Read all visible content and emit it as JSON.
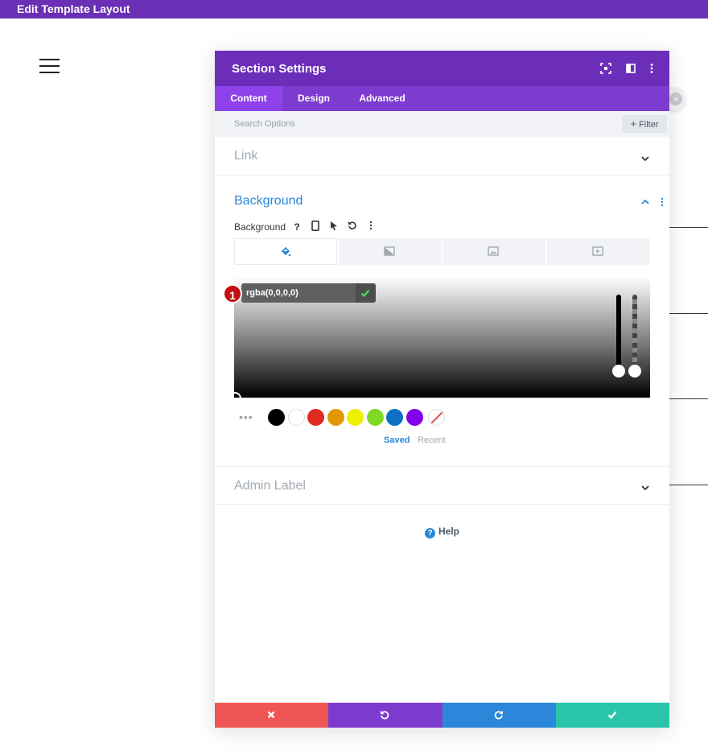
{
  "topbar": {
    "title": "Edit Template Layout"
  },
  "modal": {
    "title": "Section Settings",
    "tabs": [
      {
        "label": "Content",
        "active": true
      },
      {
        "label": "Design",
        "active": false
      },
      {
        "label": "Advanced",
        "active": false
      }
    ],
    "search": {
      "placeholder": "Search Options",
      "value": ""
    },
    "filter_label": "Filter",
    "sections": {
      "link": {
        "title": "Link",
        "state": "collapsed"
      },
      "background": {
        "title": "Background",
        "state": "expanded",
        "field_label": "Background",
        "field_tools": [
          "help-icon",
          "mobile-icon",
          "hover-cursor-icon",
          "reset-icon",
          "more-options-icon"
        ],
        "type_tabs": [
          "color-fill-icon",
          "gradient-icon",
          "image-icon",
          "video-icon"
        ],
        "active_type": "color",
        "color_value": "rgba(0,0,0,0)",
        "step_badge": "1",
        "swatches": [
          "#000000",
          "#ffffff",
          "#e02b20",
          "#e09900",
          "#edf000",
          "#7cda24",
          "#0c71c3",
          "#8300e9",
          "none"
        ],
        "palette_tabs": [
          {
            "label": "Saved",
            "active": true
          },
          {
            "label": "Recent",
            "active": false
          }
        ]
      },
      "admin_label": {
        "title": "Admin Label",
        "state": "collapsed"
      }
    },
    "help_label": "Help",
    "footer": [
      {
        "action": "cancel",
        "icon": "close-icon",
        "color": "#ef5555"
      },
      {
        "action": "undo",
        "icon": "undo-icon",
        "color": "#7e3bd0"
      },
      {
        "action": "redo",
        "icon": "redo-icon",
        "color": "#2b87da"
      },
      {
        "action": "save",
        "icon": "check-icon",
        "color": "#29c4a9"
      }
    ]
  },
  "colors": {
    "header": "#6c2eb9",
    "tabs": "#7d3bd0",
    "active_tab": "#8f42ec",
    "accent": "#2b87da"
  }
}
